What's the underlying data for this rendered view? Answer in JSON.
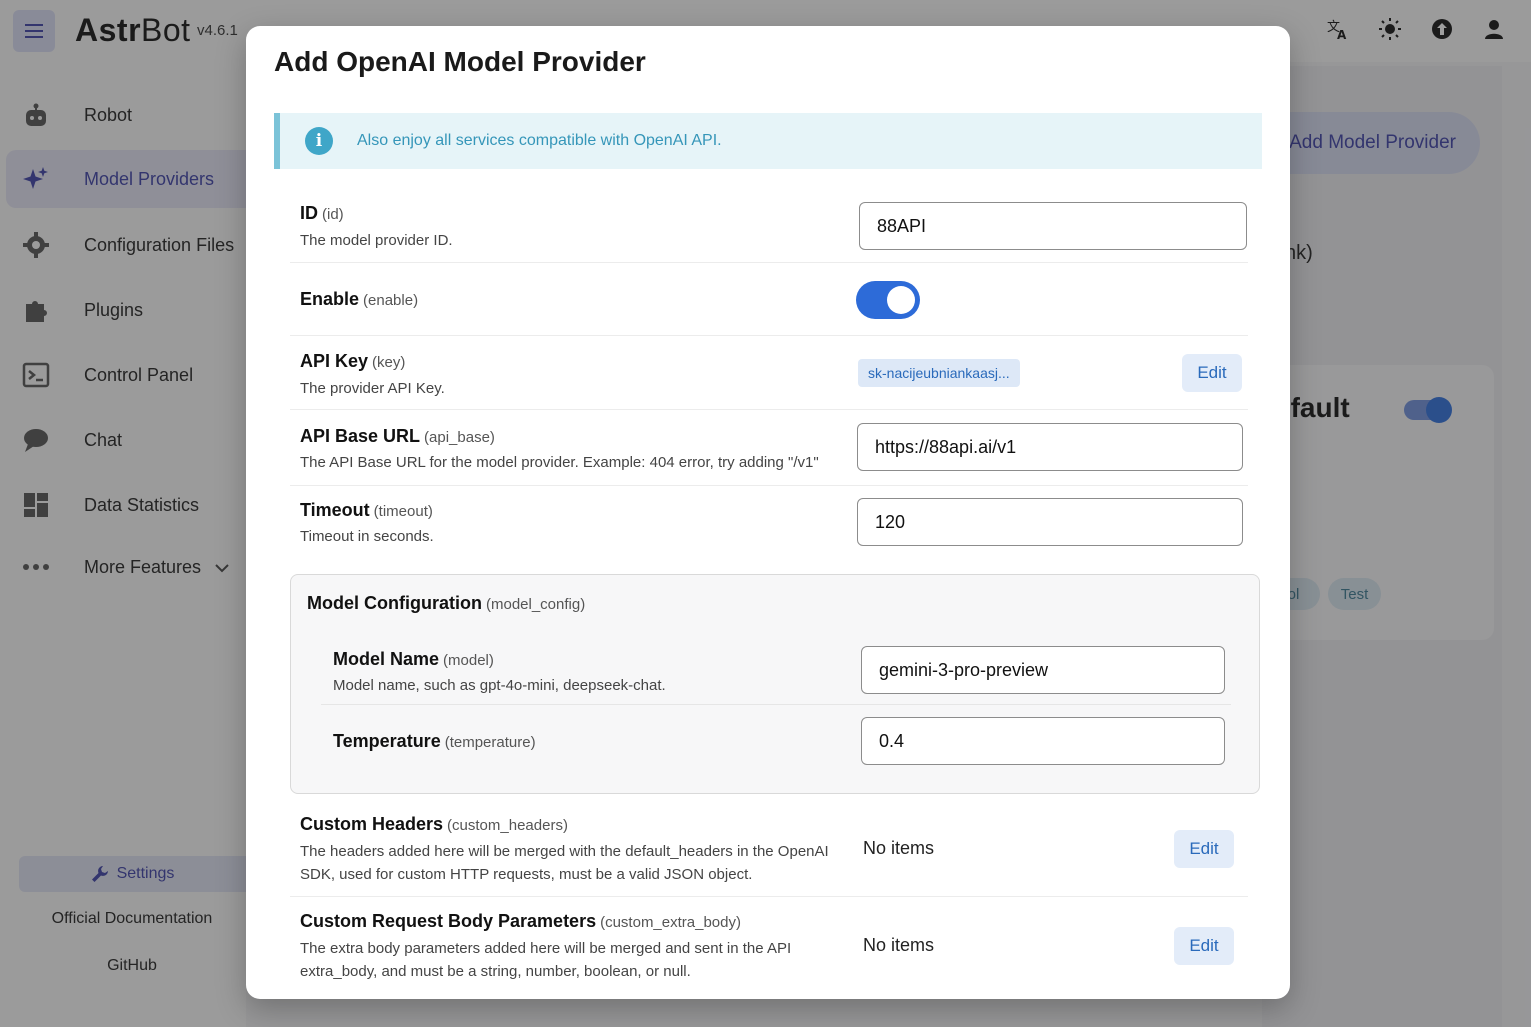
{
  "app": {
    "brand_bold": "Astr",
    "brand_light": "Bot",
    "version": "v4.6.1"
  },
  "sidebar": {
    "items": [
      {
        "label": "Robot",
        "icon": "robot-icon"
      },
      {
        "label": "Model Providers",
        "icon": "sparkle-icon",
        "active": true
      },
      {
        "label": "Configuration Files",
        "icon": "gear-icon"
      },
      {
        "label": "Plugins",
        "icon": "puzzle-icon"
      },
      {
        "label": "Control Panel",
        "icon": "terminal-icon"
      },
      {
        "label": "Chat",
        "icon": "chat-bubble-icon"
      },
      {
        "label": "Data Statistics",
        "icon": "dashboard-icon"
      },
      {
        "label": "More Features",
        "icon": "more-dots-icon"
      }
    ],
    "settings_label": "Settings",
    "docs_label": "Official Documentation",
    "github_label": "GitHub"
  },
  "background": {
    "add_provider_label": "Add Model Provider",
    "partial_text": "nk)",
    "partial_default": "efault",
    "chip_partial": "rol",
    "chip_test": "Test"
  },
  "dialog": {
    "title": "Add OpenAI Model Provider",
    "info": "Also enjoy all services compatible with OpenAI API.",
    "fields": {
      "id": {
        "label": "ID",
        "key": "(id)",
        "desc": "The model provider ID.",
        "value": "88API"
      },
      "enable": {
        "label": "Enable",
        "key": "(enable)",
        "enabled": true
      },
      "api_key": {
        "label": "API Key",
        "key": "(key)",
        "desc": "The provider API Key.",
        "value": "sk-nacijeubniankaasj...",
        "edit_label": "Edit"
      },
      "api_base": {
        "label": "API Base URL",
        "key": "(api_base)",
        "desc": "The API Base URL for the model provider. Example: 404 error, try adding \"/v1\"",
        "value": "https://88api.ai/v1"
      },
      "timeout": {
        "label": "Timeout",
        "key": "(timeout)",
        "desc": "Timeout in seconds.",
        "value": "120"
      },
      "model_config": {
        "label": "Model Configuration",
        "key": "(model_config)",
        "model": {
          "label": "Model Name",
          "key": "(model)",
          "desc": "Model name, such as gpt-4o-mini, deepseek-chat.",
          "value": "gemini-3-pro-preview"
        },
        "temperature": {
          "label": "Temperature",
          "key": "(temperature)",
          "value": "0.4"
        }
      },
      "custom_headers": {
        "label": "Custom Headers",
        "key": "(custom_headers)",
        "desc": "The headers added here will be merged with the default_headers in the OpenAI SDK, used for custom HTTP requests, must be a valid JSON object.",
        "status": "No items",
        "edit_label": "Edit"
      },
      "custom_extra_body": {
        "label": "Custom Request Body Parameters",
        "key": "(custom_extra_body)",
        "desc": "The extra body parameters added here will be merged and sent in the API extra_body, and must be a string, number, boolean, or null.",
        "status": "No items",
        "edit_label": "Edit"
      }
    }
  },
  "colors": {
    "primary": "#2d6bd8",
    "accent": "#3d40a8",
    "info": "#3596b9"
  }
}
